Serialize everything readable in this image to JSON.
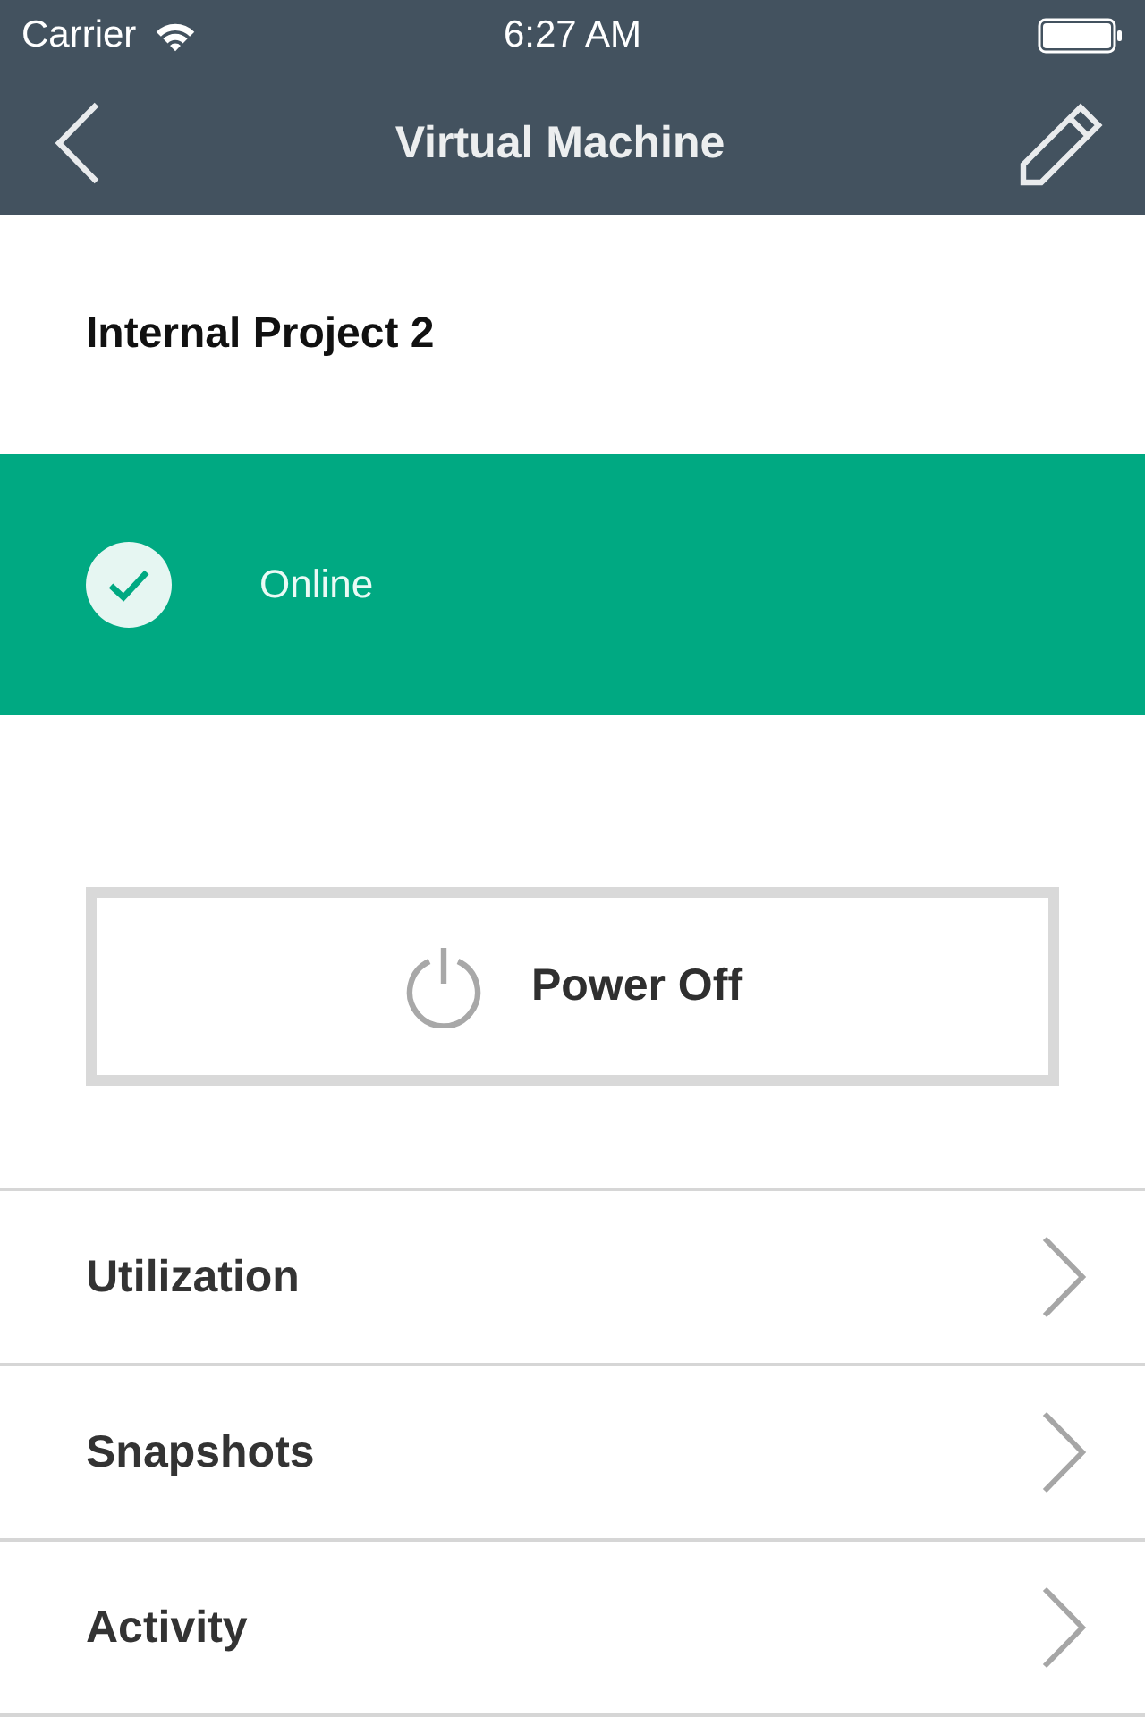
{
  "status_bar": {
    "carrier": "Carrier",
    "time": "6:27 AM"
  },
  "nav_bar": {
    "title": "Virtual Machine"
  },
  "header": {
    "title": "Internal Project 2"
  },
  "status": {
    "online": true,
    "label": "Online"
  },
  "power_button": {
    "label": "Power Off"
  },
  "menu": [
    {
      "label": "Utilization"
    },
    {
      "label": "Snapshots"
    },
    {
      "label": "Activity"
    }
  ]
}
